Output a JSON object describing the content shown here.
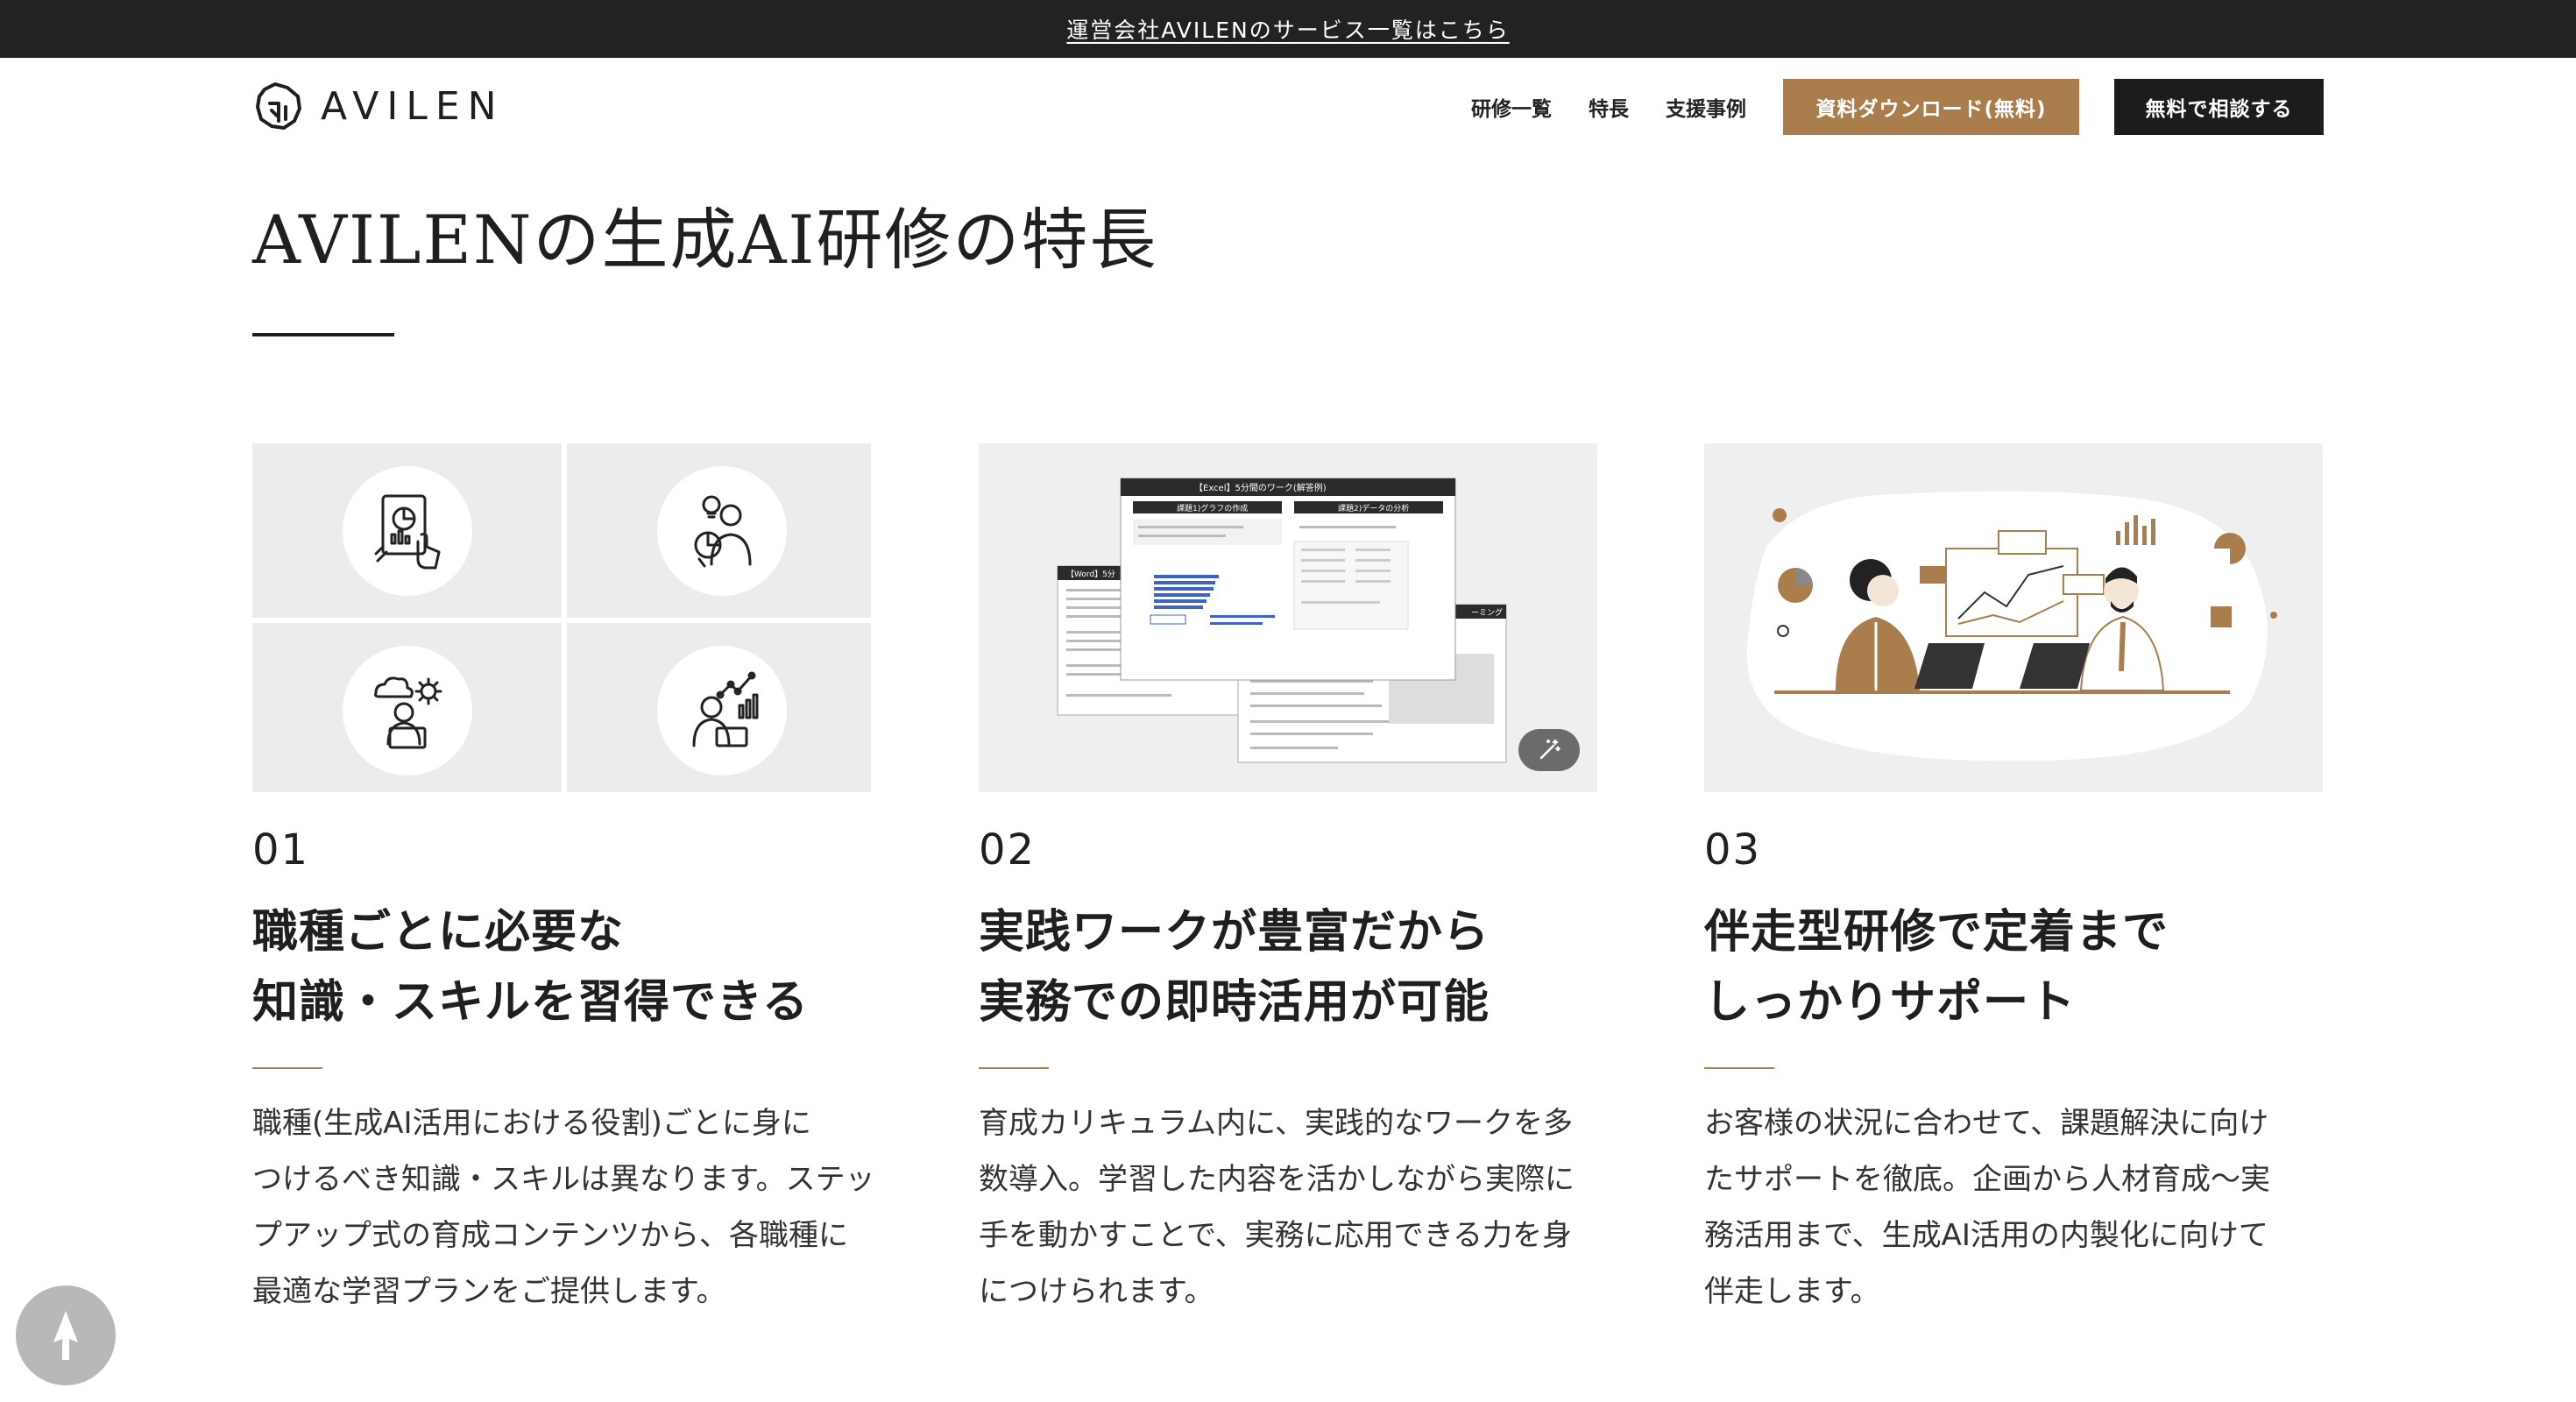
{
  "announcement": {
    "text": "運営会社AVILENのサービス一覧はこちら"
  },
  "header": {
    "logo_text": "AVILEN",
    "nav": [
      {
        "label": "研修一覧"
      },
      {
        "label": "特長"
      },
      {
        "label": "支援事例"
      }
    ],
    "download_button": "資料ダウンロード(無料)",
    "consult_button": "無料で相談する"
  },
  "section": {
    "title": "AVILENの生成AI研修の特長"
  },
  "cards": [
    {
      "number": "01",
      "heading_lines": [
        "職種ごとに必要な",
        "知識・スキルを習得できる"
      ],
      "description_lines": [
        "職種(生成AI活用における役割)ごとに身に",
        "つけるべき知識・スキルは異なります。ステッ",
        "プアップ式の育成コンテンツから、各職種に",
        "最適な学習プランをご提供します。"
      ],
      "icons": [
        "tablet-chart-icon",
        "idea-person-chart-icon",
        "cloud-gear-person-icon",
        "analyst-growth-icon"
      ]
    },
    {
      "number": "02",
      "heading_lines": [
        "実践ワークが豊富だから",
        "実務での即時活用が可能"
      ],
      "description_lines": [
        "育成カリキュラム内に、実践的なワークを多",
        "数導入。学習した内容を活かしながら実際に",
        "手を動かすことで、実務に応用できる力を身",
        "につけられます。"
      ],
      "image": {
        "front_header": "【Excel】5分間のワーク(解答例)",
        "front_task1": "課題1)グラフの作成",
        "front_task2": "課題2)データの分析",
        "left_header": "【Word】5分",
        "right_header": "ーミング"
      }
    },
    {
      "number": "03",
      "heading_lines": [
        "伴走型研修で定着まで",
        "しっかりサポート"
      ],
      "description_lines": [
        "お客様の状況に合わせて、課題解決に向け",
        "たサポートを徹底。企画から人材育成〜実",
        "務活用まで、生成AI活用の内製化に向けて",
        "伴走します。"
      ]
    }
  ],
  "colors": {
    "accent": "#a97e4c",
    "dark": "#1c1c1c",
    "announce_bg": "#222222"
  }
}
